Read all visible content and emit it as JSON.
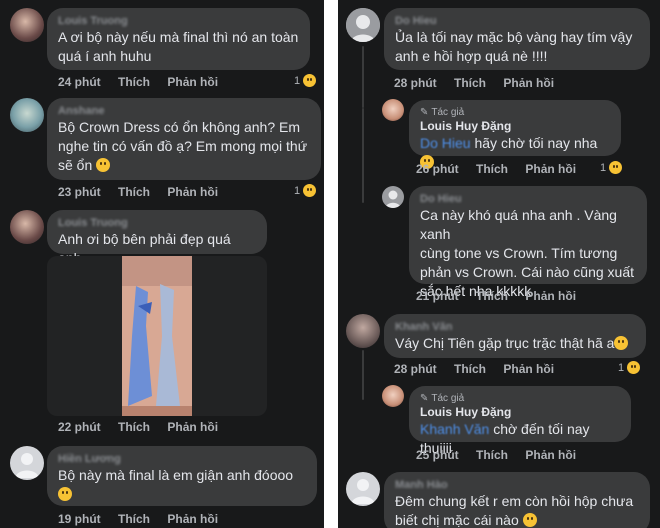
{
  "left": {
    "comments": [
      {
        "name": "Louis Truong",
        "lines": [
          "A ơi bộ này nếu mà final thì nó an toàn",
          "quá í anh huhu"
        ],
        "time": "24 phút",
        "like": "Thích",
        "reply": "Phản hồi",
        "reaction_count": "1"
      },
      {
        "name": "Anshane",
        "lines": [
          "Bộ Crown Dress có ổn không anh? Em",
          "nghe tin có vấn đồ ạ? Em mong mọi thứ",
          "sẽ ổn"
        ],
        "time": "23 phút",
        "like": "Thích",
        "reply": "Phản hồi",
        "reaction_count": "1"
      },
      {
        "name": "Louis Truong",
        "lines": [
          "Anh ơi bộ bên phải đẹp quá anh"
        ],
        "time": "22 phút",
        "like": "Thích",
        "reply": "Phản hồi"
      },
      {
        "name": "Hiền Lương",
        "lines": [
          "Bộ này mà final là em giận anh đóooo"
        ],
        "time": "19 phút",
        "like": "Thích",
        "reply": "Phản hồi"
      }
    ]
  },
  "right": {
    "comments": [
      {
        "name": "Do Hieu",
        "lines": [
          "Ủa là tối nay mặc bộ vàng hay tím vậy",
          "anh e hồi hợp quá nè !!!!"
        ],
        "time": "28 phút",
        "like": "Thích",
        "reply": "Phản hồi"
      },
      {
        "author_badge": "Tác giả",
        "name": "Louis Huy Đặng",
        "tag": "Do Hieu",
        "text": "hãy chờ tối nay nha",
        "time": "26 phút",
        "like": "Thích",
        "reply": "Phản hồi",
        "reaction_count": "1"
      },
      {
        "name": "Do Hieu",
        "lines": [
          "Ca này khó quá nha anh . Vàng xanh",
          "cùng tone vs Crown. Tím tương",
          "phản vs Crown. Cái nào cũng xuất",
          "sắc hết nha kkkkk"
        ],
        "time": "21 phút",
        "like": "Thích",
        "reply": "Phản hồi"
      },
      {
        "name": "Khanh Văn",
        "lines": [
          "Váy Chị Tiên gặp trục trặc thật hã a"
        ],
        "time": "28 phút",
        "like": "Thích",
        "reply": "Phản hồi",
        "reaction_count": "1"
      },
      {
        "author_badge": "Tác giả",
        "name": "Louis Huy Đặng",
        "tag": "Khanh Văn",
        "text": "chờ đến tối nay thuiiii",
        "time": "25 phút",
        "like": "Thích",
        "reply": "Phản hồi"
      },
      {
        "name": "Manh Hào",
        "lines": [
          "Đêm chung kết r em còn hồi hộp chưa",
          "biết chị mặc cái nào"
        ]
      }
    ]
  },
  "colors": {
    "background": "#18191a",
    "bubble": "#3a3b3c",
    "text": "#e4e6eb",
    "meta": "#b0b3b8",
    "tag": "#4e8fe8"
  }
}
